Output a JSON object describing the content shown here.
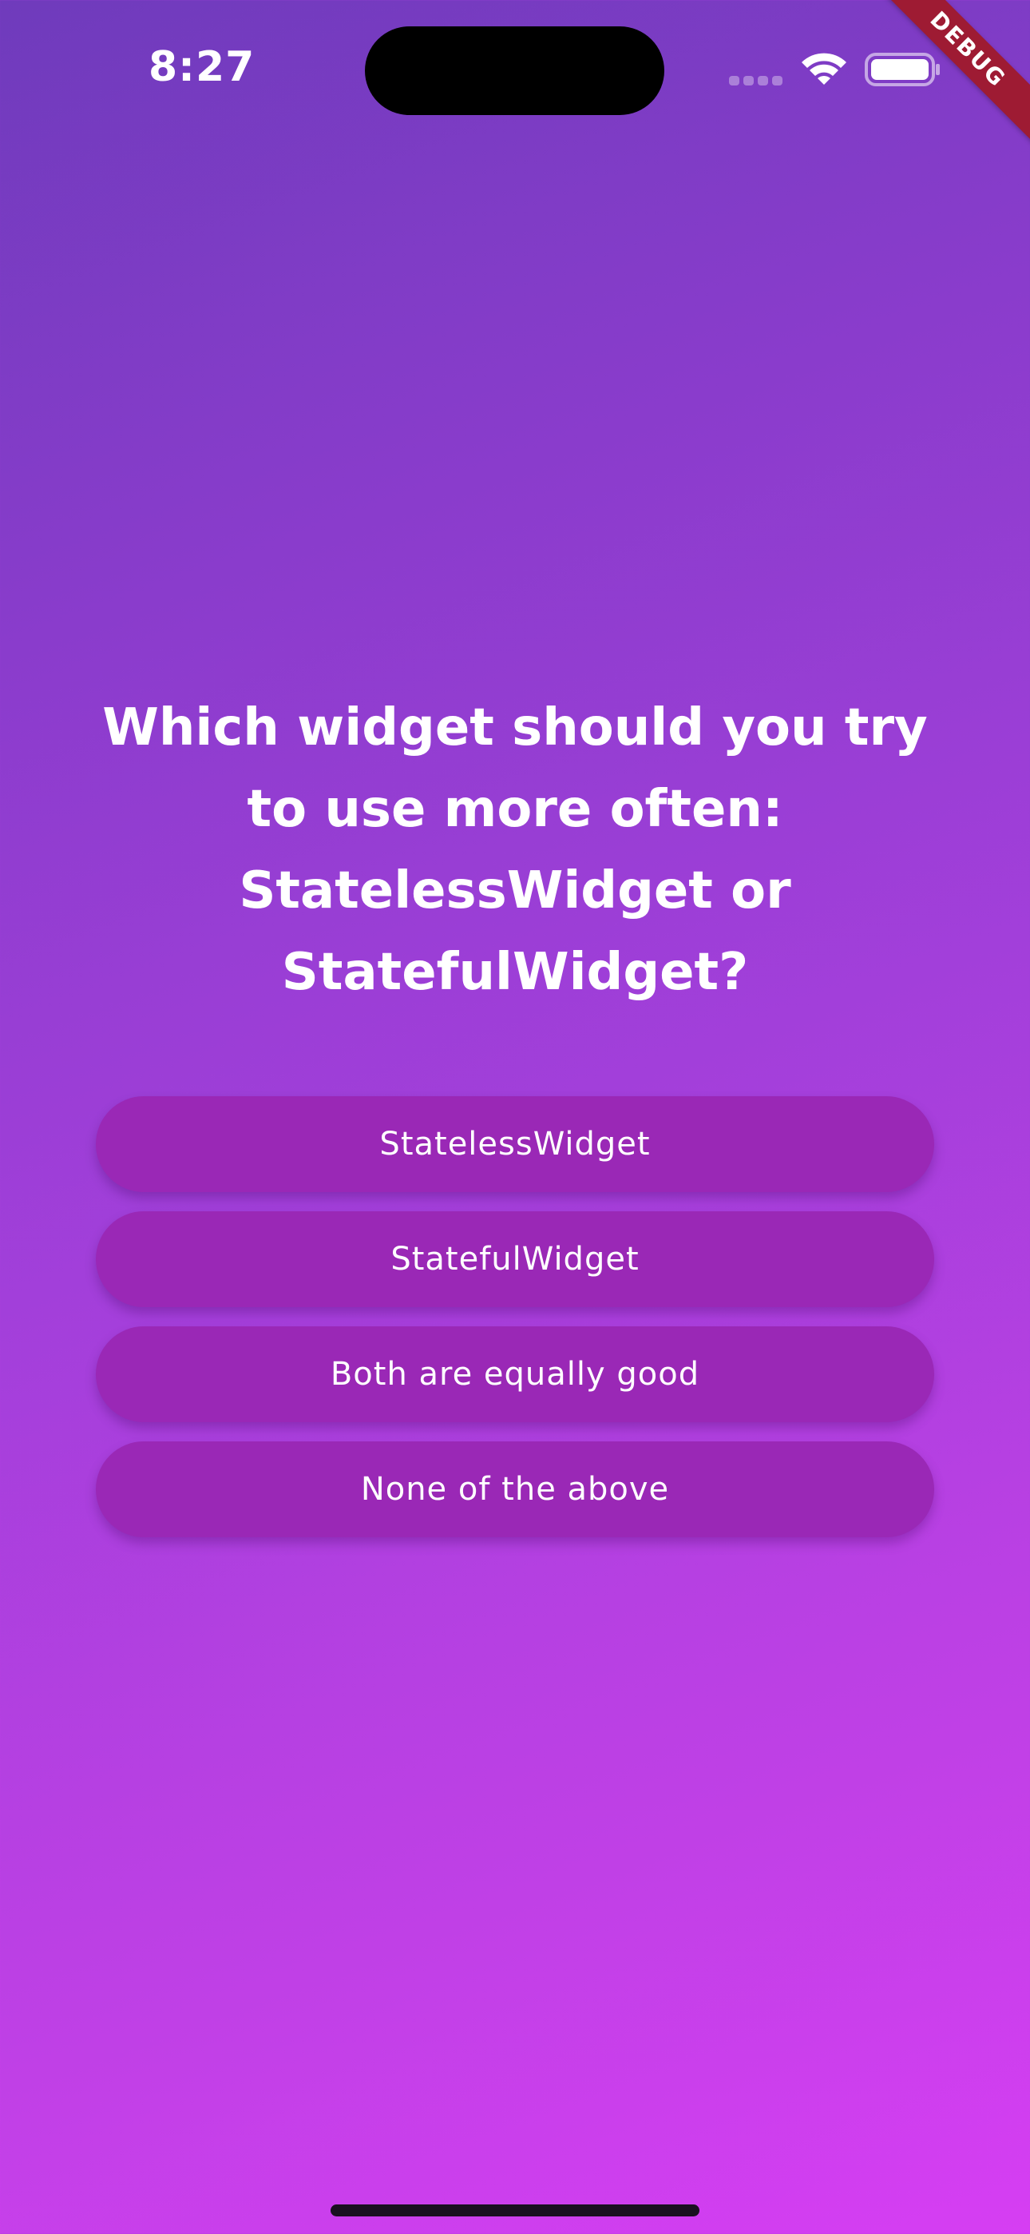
{
  "status_bar": {
    "time": "8:27",
    "icons": [
      "cellular-signal-icon",
      "wifi-icon",
      "battery-icon"
    ]
  },
  "debug_banner": {
    "label": "DEBUG"
  },
  "quiz": {
    "question": "Which widget should you try to use more often: StatelessWidget or StatefulWidget?",
    "answers": [
      "StatelessWidget",
      "StatefulWidget",
      "Both are equally good",
      "None of the above"
    ]
  },
  "colors": {
    "gradient_start": "#6f3bbc",
    "gradient_end": "#d63ef3",
    "button_background": "#9a28b6",
    "debug_banner": "#9e1b33",
    "text": "#ffffff"
  }
}
